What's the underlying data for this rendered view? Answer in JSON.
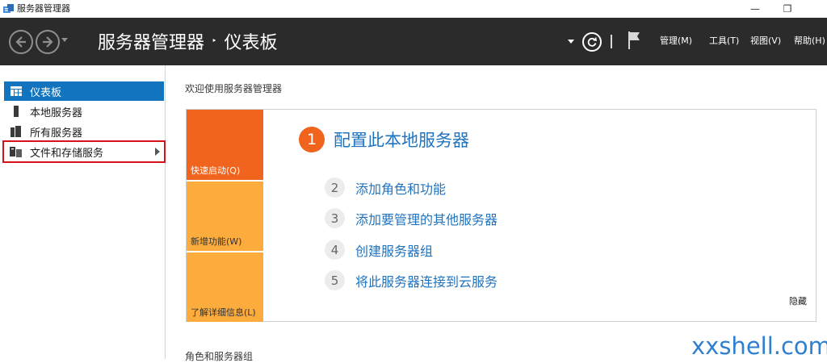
{
  "window": {
    "title": "服务器管理器",
    "controls": {
      "minimize": "—",
      "restore": "❐"
    }
  },
  "header": {
    "breadcrumb_root": "服务器管理器",
    "breadcrumb_separator": "‣",
    "breadcrumb_current": "仪表板",
    "menus": [
      "管理(M)",
      "工具(T)",
      "视图(V)",
      "帮助(H)"
    ],
    "icons": [
      "back-arrow-icon",
      "forward-arrow-icon",
      "refresh-icon",
      "flag-icon"
    ]
  },
  "sidebar": {
    "items": [
      {
        "label": "仪表板",
        "icon": "dashboard-grid-icon",
        "active": true
      },
      {
        "label": "本地服务器",
        "icon": "single-server-icon"
      },
      {
        "label": "所有服务器",
        "icon": "multi-server-icon"
      },
      {
        "label": "文件和存储服务",
        "icon": "file-storage-icon",
        "highlighted": true,
        "has_submenu": true
      }
    ]
  },
  "main": {
    "welcome_title": "欢迎使用服务器管理器",
    "tiles": [
      "快速启动(Q)",
      "新增功能(W)",
      "了解详细信息(L)"
    ],
    "step1": {
      "number": "1",
      "label": "配置此本地服务器"
    },
    "steps": [
      {
        "number": "2",
        "label": "添加角色和功能"
      },
      {
        "number": "3",
        "label": "添加要管理的其他服务器"
      },
      {
        "number": "4",
        "label": "创建服务器组"
      },
      {
        "number": "5",
        "label": "将此服务器连接到云服务"
      }
    ],
    "hide_link": "隐藏",
    "roles_title": "角色和服务器组"
  },
  "watermark": "xxshell.com",
  "colors": {
    "header_bg": "#2b2b2b",
    "accent_blue": "#1274be",
    "link_blue": "#1f73bf",
    "orange": "#f0641e",
    "amber": "#fbac3c",
    "highlight_red": "#d6121b"
  }
}
